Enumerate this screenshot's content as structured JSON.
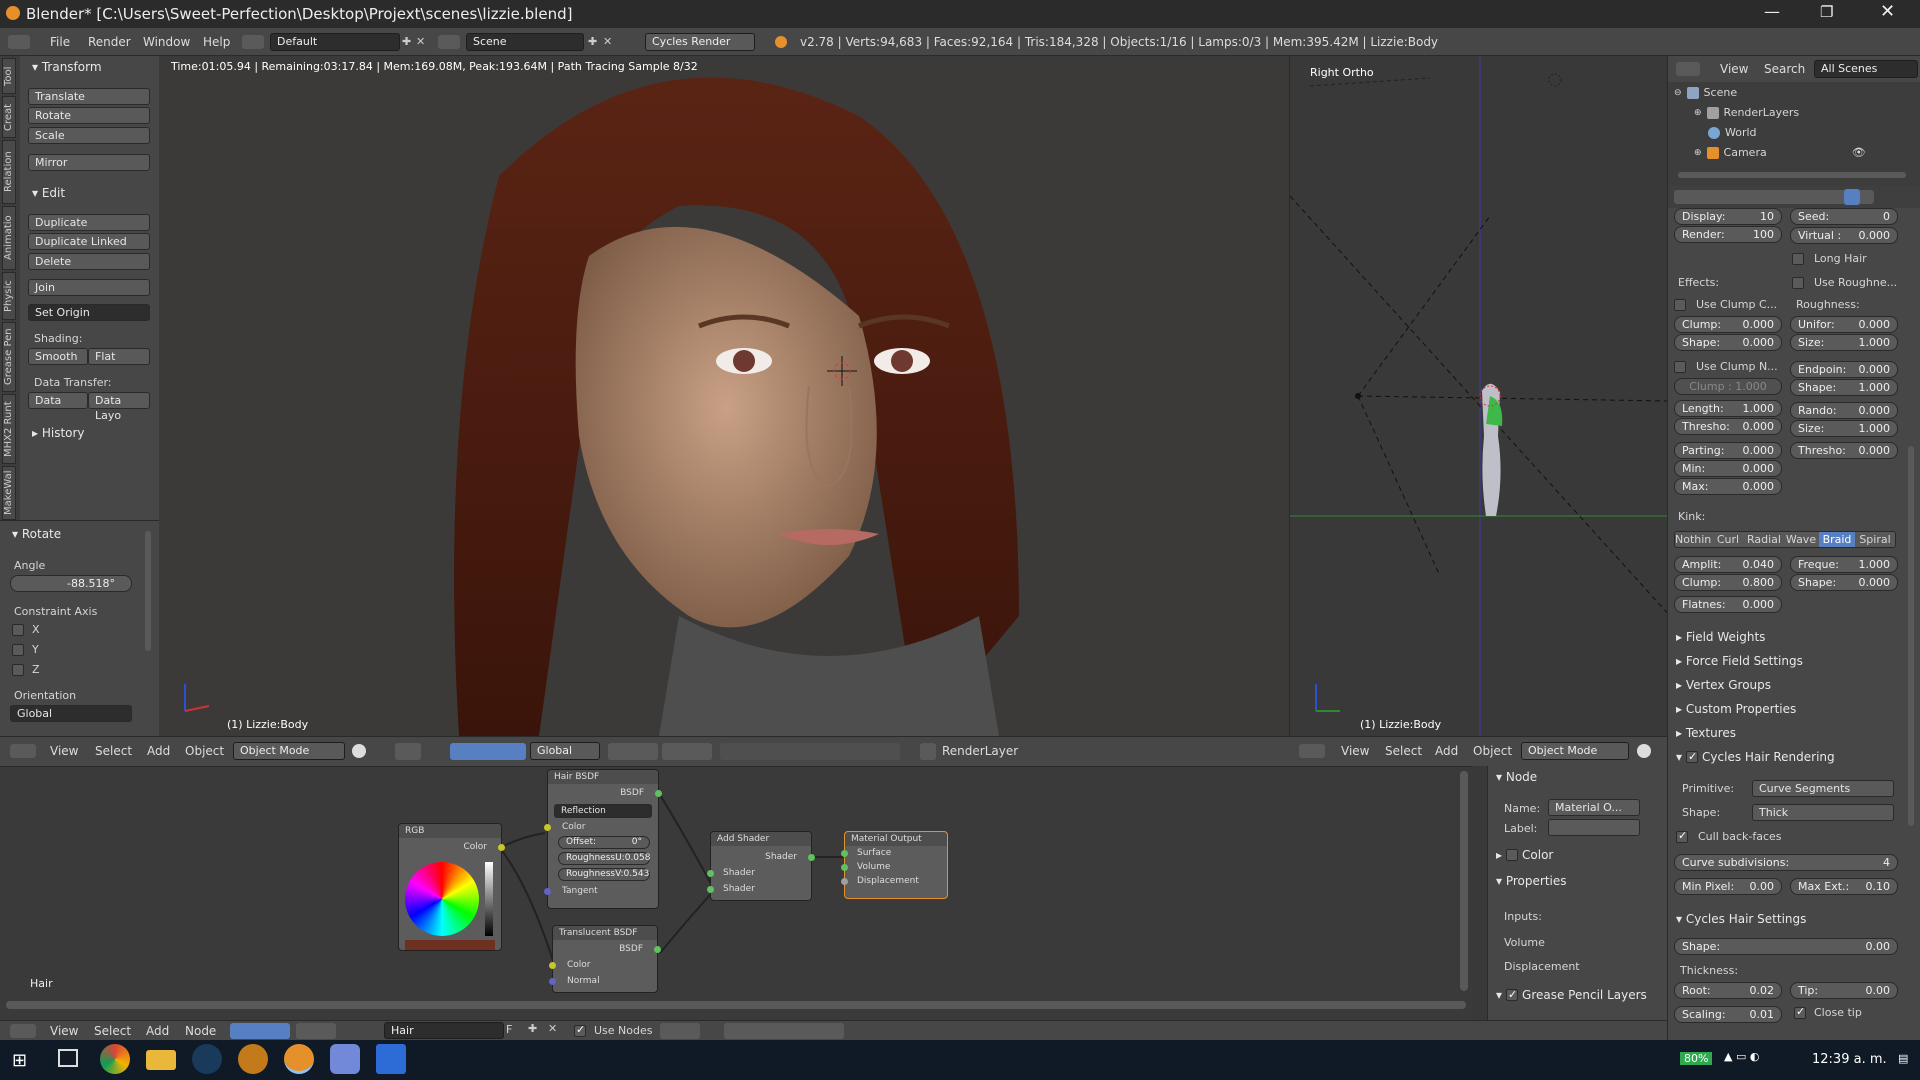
{
  "window": {
    "title": "Blender* [C:\\Users\\Sweet-Perfection\\Desktop\\Projext\\scenes\\lizzie.blend]"
  },
  "menu": {
    "file": "File",
    "render": "Render",
    "window": "Window",
    "help": "Help",
    "layout": "Default",
    "scene": "Scene",
    "engine": "Cycles Render",
    "stats": "v2.78 | Verts:94,683 | Faces:92,164 | Tris:184,328 | Objects:1/16 | Lamps:0/3 | Mem:395.42M | Lizzie:Body"
  },
  "tool_tabs": [
    "Tool",
    "Creat",
    "Relation",
    "Animatio",
    "Physic",
    "Grease Pen",
    "MHX2 Runt",
    "MakeWal"
  ],
  "toolshelf": {
    "transform_hdr": "Transform",
    "translate": "Translate",
    "rotate": "Rotate",
    "scale": "Scale",
    "mirror": "Mirror",
    "edit_hdr": "Edit",
    "duplicate": "Duplicate",
    "duplicate_linked": "Duplicate Linked",
    "delete": "Delete",
    "join": "Join",
    "set_origin": "Set Origin",
    "shading": "Shading:",
    "smooth": "Smooth",
    "flat": "Flat",
    "data_transfer": "Data Transfer:",
    "data": "Data",
    "data_layo": "Data Layo",
    "history_hdr": "History"
  },
  "operator": {
    "hdr": "Rotate",
    "angle_label": "Angle",
    "angle": "-88.518°",
    "constraint": "Constraint Axis",
    "x": "X",
    "y": "Y",
    "z": "Z",
    "orientation": "Orientation",
    "orientation_value": "Global"
  },
  "viewport_main": {
    "info": "Time:01:05.94 | Remaining:03:17.84 | Mem:169.08M, Peak:193.64M | Path Tracing Sample 8/32",
    "object": "(1) Lizzie:Body"
  },
  "viewport_right": {
    "label": "Right Ortho",
    "object": "(1) Lizzie:Body"
  },
  "header3d": {
    "view": "View",
    "select": "Select",
    "add": "Add",
    "object": "Object",
    "mode": "Object Mode",
    "orientation": "Global",
    "renderlayer": "RenderLayer"
  },
  "header3d_right": {
    "view": "View",
    "select": "Select",
    "add": "Add",
    "object": "Object",
    "mode": "Object Mode"
  },
  "outliner": {
    "view": "View",
    "search": "Search",
    "filter": "All Scenes",
    "scene": "Scene",
    "renderlayers": "RenderLayers",
    "world": "World",
    "camera": "Camera"
  },
  "props": {
    "display_label": "Display:",
    "display": "10",
    "render_label": "Render:",
    "render": "100",
    "seed_label": "Seed:",
    "seed": "0",
    "virtual_label": "Virtual :",
    "virtual": "0.000",
    "long_hair": "Long Hair",
    "effects": "Effects:",
    "use_roughness": "Use Roughne...",
    "use_clump_c": "Use Clump C...",
    "roughness": "Roughness:",
    "clump_label": "Clump:",
    "clump": "0.000",
    "unifor_label": "Unifor:",
    "unifor": "0.000",
    "shape_label": "Shape:",
    "shape": "0.000",
    "size_label": "Size:",
    "size": "1.000",
    "use_clump_n": "Use Clump N...",
    "endpoin_label": "Endpoin:",
    "endpoin": "0.000",
    "clump2": "Clump : 1.000",
    "shape2_label": "Shape:",
    "shape2": "1.000",
    "length_label": "Length:",
    "length": "1.000",
    "rando_label": "Rando:",
    "rando": "0.000",
    "thresho_label": "Thresho:",
    "thresho": "0.000",
    "size2_label": "Size:",
    "size2": "1.000",
    "parting_label": "Parting:",
    "parting": "0.000",
    "thresho2_label": "Thresho:",
    "thresho2": "0.000",
    "min_label": "Min:",
    "min": "0.000",
    "max_label": "Max:",
    "max": "0.000",
    "kink": "Kink:",
    "kink_tabs": [
      "Nothin",
      "Curl",
      "Radial",
      "Wave",
      "Braid",
      "Spiral"
    ],
    "amplit_label": "Amplit:",
    "amplit": "0.040",
    "freque_label": "Freque:",
    "freque": "1.000",
    "clump3_label": "Clump:",
    "clump3": "0.800",
    "shape3_label": "Shape:",
    "shape3": "0.000",
    "flatnes_label": "Flatnes:",
    "flatnes": "0.000",
    "field_weights": "Field Weights",
    "force_field": "Force Field Settings",
    "vertex_groups": "Vertex Groups",
    "custom_props": "Custom Properties",
    "textures": "Textures",
    "cycles_hair_rendering": "Cycles Hair Rendering",
    "primitive_label": "Primitive:",
    "primitive": "Curve Segments",
    "shape_sel_label": "Shape:",
    "shape_sel": "Thick",
    "cull": "Cull back-faces",
    "curve_subdiv_label": "Curve subdivisions:",
    "curve_subdiv": "4",
    "min_pixel_label": "Min Pixel:",
    "min_pixel": "0.00",
    "max_ext_label": "Max Ext.:",
    "max_ext": "0.10",
    "cycles_hair_settings": "Cycles Hair Settings",
    "shape4_label": "Shape:",
    "shape4": "0.00",
    "thickness": "Thickness:",
    "root_label": "Root:",
    "root": "0.02",
    "tip_label": "Tip:",
    "tip": "0.00",
    "scaling_label": "Scaling:",
    "scaling": "0.01",
    "close_tip": "Close tip"
  },
  "nodes": {
    "rgb": "RGB",
    "rgb_color": "Color",
    "hair": "Hair BSDF",
    "hair_out": "BSDF",
    "reflection": "Reflection",
    "color": "Color",
    "offset_label": "Offset:",
    "offset": "0°",
    "rough_u": "RoughnessU:0.058",
    "rough_v": "RoughnessV:0.543",
    "tangent": "Tangent",
    "translucent": "Translucent BSDF",
    "trans_out": "BSDF",
    "trans_color": "Color",
    "normal": "Normal",
    "add": "Add Shader",
    "add_out": "Shader",
    "shader1": "Shader",
    "shader2": "Shader",
    "output": "Material Output",
    "surface": "Surface",
    "volume": "Volume",
    "displacement": "Displacement",
    "material_name": "Hair"
  },
  "node_side": {
    "node_hdr": "Node",
    "name_label": "Name:",
    "name": "Material O...",
    "label_label": "Label:",
    "color": "Color",
    "properties": "Properties",
    "inputs": "Inputs:",
    "volume": "Volume",
    "displacement": "Displacement",
    "grease": "Grease Pencil Layers"
  },
  "node_header": {
    "view": "View",
    "select": "Select",
    "add": "Add",
    "node": "Node",
    "material": "Hair",
    "f": "F",
    "use_nodes": "Use Nodes"
  },
  "taskbar": {
    "battery": "80%",
    "time": "12:39 a. m."
  },
  "colors": {
    "accent": "#5680c2",
    "orange": "#e5902b",
    "bg": "#393939"
  }
}
